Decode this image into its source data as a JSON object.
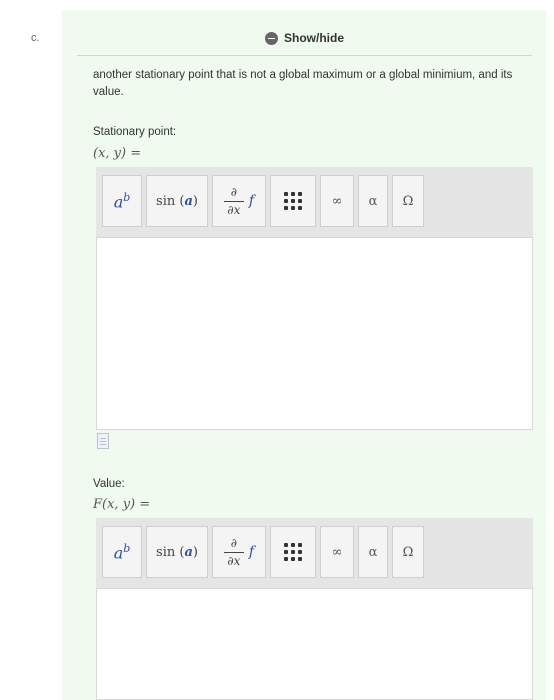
{
  "part": {
    "label": "c."
  },
  "toggle": {
    "label": "Show/hide",
    "icon": "minus-circle-icon"
  },
  "question": {
    "text": "another stationary point that is not a global maximum or a global minimium, and its value."
  },
  "stationary": {
    "label": "Stationary point:",
    "math": "(x, y) ="
  },
  "value": {
    "label": "Value:",
    "math": "F(x, y) ="
  },
  "toolbar": {
    "power": {
      "base": "a",
      "exp": "b"
    },
    "trig": {
      "fn": "sin",
      "arg": "a"
    },
    "deriv": {
      "num": "∂",
      "den": "∂x",
      "fn": "f"
    },
    "matrix_icon": "matrix-grid-icon",
    "infinity": "∞",
    "alpha": "α",
    "omega": "Ω"
  },
  "colors": {
    "panel": "#effbef",
    "accent": "#2a4ea8"
  }
}
